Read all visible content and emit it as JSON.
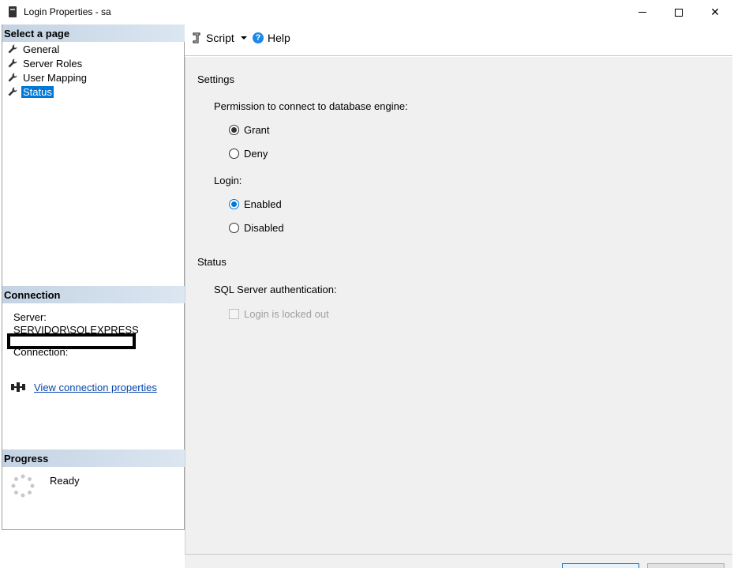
{
  "window": {
    "title": "Login Properties - sa",
    "minimize_label": "",
    "maximize_label": "",
    "close_label": "✕"
  },
  "select_page": {
    "header": "Select a page",
    "items": [
      {
        "label": "General",
        "selected": false
      },
      {
        "label": "Server Roles",
        "selected": false
      },
      {
        "label": "User Mapping",
        "selected": false
      },
      {
        "label": "Status",
        "selected": true
      }
    ]
  },
  "connection": {
    "header": "Connection",
    "server_label": "Server:",
    "server_value": "SERVIDOR\\SQLEXPRESS",
    "connection_label": "Connection:",
    "view_link": "View connection properties"
  },
  "progress": {
    "header": "Progress",
    "status": "Ready"
  },
  "toolbar": {
    "script_label": "Script",
    "help_label": "Help"
  },
  "settings": {
    "heading": "Settings",
    "permission_label": "Permission to connect to database engine:",
    "grant_label": "Grant",
    "deny_label": "Deny",
    "permission_selected": "Grant",
    "login_label": "Login:",
    "enabled_label": "Enabled",
    "disabled_label": "Disabled",
    "login_selected": "Enabled"
  },
  "status": {
    "heading": "Status",
    "auth_label": "SQL Server authentication:",
    "locked_out_label": "Login is locked out",
    "locked_out_checked": false
  },
  "colors": {
    "selection": "#0078d7",
    "link": "#0645ad",
    "header_gradient_start": "#c4d3e3",
    "content_bg": "#f0f0f0"
  }
}
